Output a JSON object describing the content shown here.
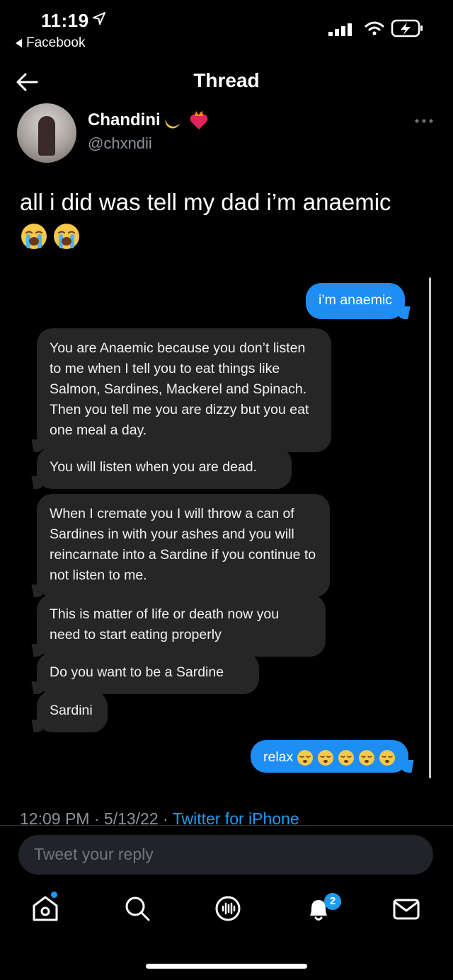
{
  "status_bar": {
    "time": "11:19",
    "back_app": "Facebook"
  },
  "header": {
    "title": "Thread"
  },
  "tweet": {
    "author_name": "Chandini",
    "author_handle": "@chxndii",
    "text": "all i did was tell my dad i’m anaemic",
    "emojis": [
      "loudly-crying-face",
      "loudly-crying-face"
    ],
    "meta_time": "12:09 PM",
    "meta_sep1": " · ",
    "meta_date": "5/13/22",
    "meta_sep2": " · ",
    "meta_source": "Twitter for iPhone"
  },
  "messages": [
    {
      "from": "me",
      "text": "i’m anaemic"
    },
    {
      "from": "dad",
      "text": "You are Anaemic because you don’t listen to me when I tell you to eat things like Salmon, Sardines, Mackerel and Spinach. Then you tell me you are dizzy but you eat one meal a day."
    },
    {
      "from": "dad",
      "text": "You will listen when you are dead."
    },
    {
      "from": "dad",
      "text": "When I cremate you I will throw a can of Sardines in with your ashes and you will reincarnate into a Sardine if you continue to not listen to me."
    },
    {
      "from": "dad",
      "text": "This is matter of life or death now you need to start eating properly"
    },
    {
      "from": "dad",
      "text": "Do you want to be a Sardine"
    },
    {
      "from": "dad",
      "text": "Sardini"
    },
    {
      "from": "me",
      "text": "relax",
      "emoji_count": 5
    }
  ],
  "reply": {
    "placeholder": "Tweet your reply"
  },
  "tab_bar": {
    "notifications_badge": "2"
  },
  "colors": {
    "background": "#000000",
    "accent": "#1d9bf0",
    "incoming_bubble": "#262626",
    "outgoing_bubble": "#1e8ef5",
    "muted_text": "#8b9299"
  }
}
